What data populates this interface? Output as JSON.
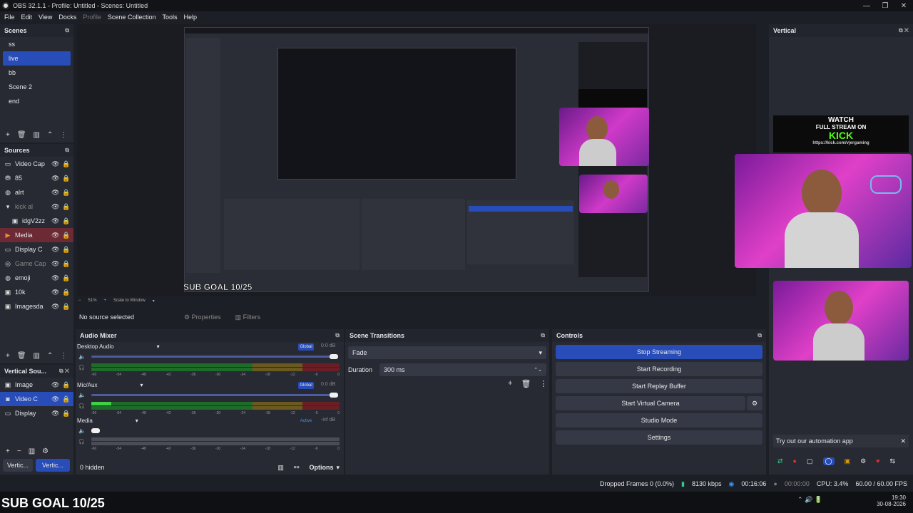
{
  "window": {
    "title": "OBS 32.1.1 - Profile: Untitled - Scenes: Untitled"
  },
  "menu": [
    "File",
    "Edit",
    "View",
    "Docks",
    "Profile",
    "Scene Collection",
    "Tools",
    "Help"
  ],
  "scenes": {
    "title": "Scenes",
    "items": [
      "ss",
      "live",
      "bb",
      "Scene 2",
      "end"
    ],
    "selected": 1
  },
  "sources": {
    "title": "Sources",
    "items": [
      "Video Cap",
      "85",
      "alrt",
      "kick al",
      "idgV2zz",
      "Media",
      "Display C",
      "Game Cap",
      "emoji",
      "10k",
      "Imagesda"
    ]
  },
  "vertical_sources": {
    "title": "Vertical Sou...",
    "items": [
      "Image",
      "Video C",
      "Display"
    ],
    "tabs": [
      "Vertic...",
      "Vertic..."
    ]
  },
  "preview": {
    "overlay_text": "SUB GOAL 10/25",
    "zoom": "51%",
    "scale_mode": "Scale to Window"
  },
  "source_bar": {
    "no_source": "No source selected",
    "properties": "Properties",
    "filters": "Filters"
  },
  "audio_mixer": {
    "title": "Audio Mixer",
    "channels": [
      {
        "name": "Desktop Audio",
        "badge": "Global",
        "db": "0.0 dB"
      },
      {
        "name": "Mic/Aux",
        "badge": "Global",
        "db": "0.0 dB"
      },
      {
        "name": "Media",
        "badge": "Active",
        "db": "-inf dB"
      }
    ],
    "scale": [
      "-60",
      "-54",
      "-48",
      "-42",
      "-36",
      "-30",
      "-24",
      "-18",
      "-12",
      "-6",
      "0"
    ],
    "hidden": "0 hidden",
    "options": "Options"
  },
  "transitions": {
    "title": "Scene Transitions",
    "selected": "Fade",
    "duration_label": "Duration",
    "duration": "300 ms"
  },
  "controls": {
    "title": "Controls",
    "buttons": [
      "Stop Streaming",
      "Start Recording",
      "Start Replay Buffer",
      "Start Virtual Camera",
      "Studio Mode",
      "Settings"
    ]
  },
  "vertical": {
    "title": "Vertical",
    "banner_l1": "WATCH",
    "banner_l2": "FULL STREAM ON",
    "banner_l3": "KICK",
    "banner_url": "https://kick.com/vjergaming",
    "promo": "Try out our automation app"
  },
  "status": {
    "dropped": "Dropped Frames 0 (0.0%)",
    "bitrate": "8130 kbps",
    "stream_time": "00:16:06",
    "rec_time": "00:00:00",
    "cpu": "CPU: 3.4%",
    "fps": "60.00 / 60.00 FPS"
  },
  "taskbar": {
    "sub_goal": "SUB GOAL 10/25",
    "time": "19:30",
    "date": "30-08-2026"
  },
  "colors": {
    "accent": "#284cb8",
    "panel": "#272a33",
    "bg": "#1d1f26",
    "pink": "#c02d9b"
  }
}
